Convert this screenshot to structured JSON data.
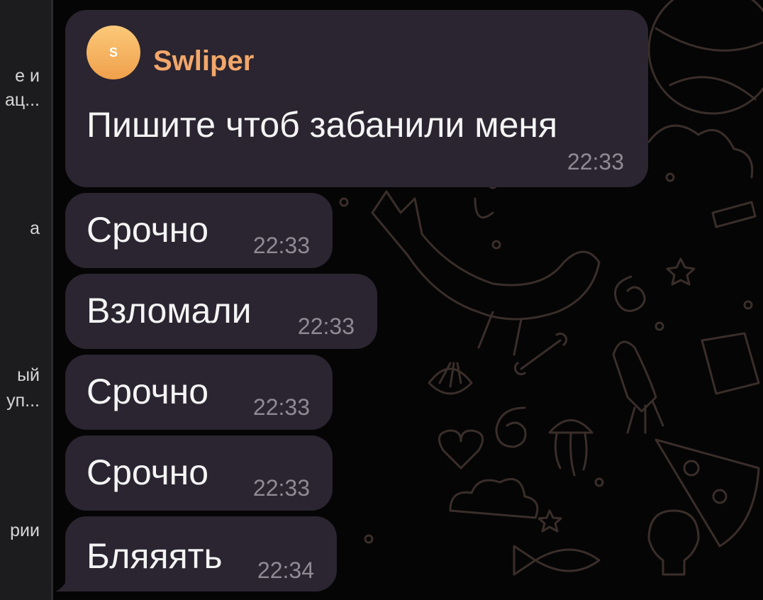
{
  "sidebar": {
    "items": [
      {
        "line1": "е и",
        "line2": "ац..."
      },
      {
        "line1": "а"
      },
      {
        "line1": "ый",
        "line2": "уп..."
      },
      {
        "line1": "рии"
      }
    ]
  },
  "chat": {
    "first_message": {
      "avatar_letter": "S",
      "sender": "Swliper",
      "text": "Пишите чтоб забанили меня",
      "time": "22:33"
    },
    "messages": [
      {
        "text": "Срочно",
        "time": "22:33"
      },
      {
        "text": "Взломали",
        "time": "22:33"
      },
      {
        "text": "Срочно",
        "time": "22:33"
      },
      {
        "text": "Срочно",
        "time": "22:33"
      },
      {
        "text": "Бляяять",
        "time": "22:34"
      }
    ]
  },
  "colors": {
    "bubble": "#2a2530",
    "sender_name": "#f2a76a",
    "background": "#050505",
    "pattern_line": "#3a2e2a"
  }
}
